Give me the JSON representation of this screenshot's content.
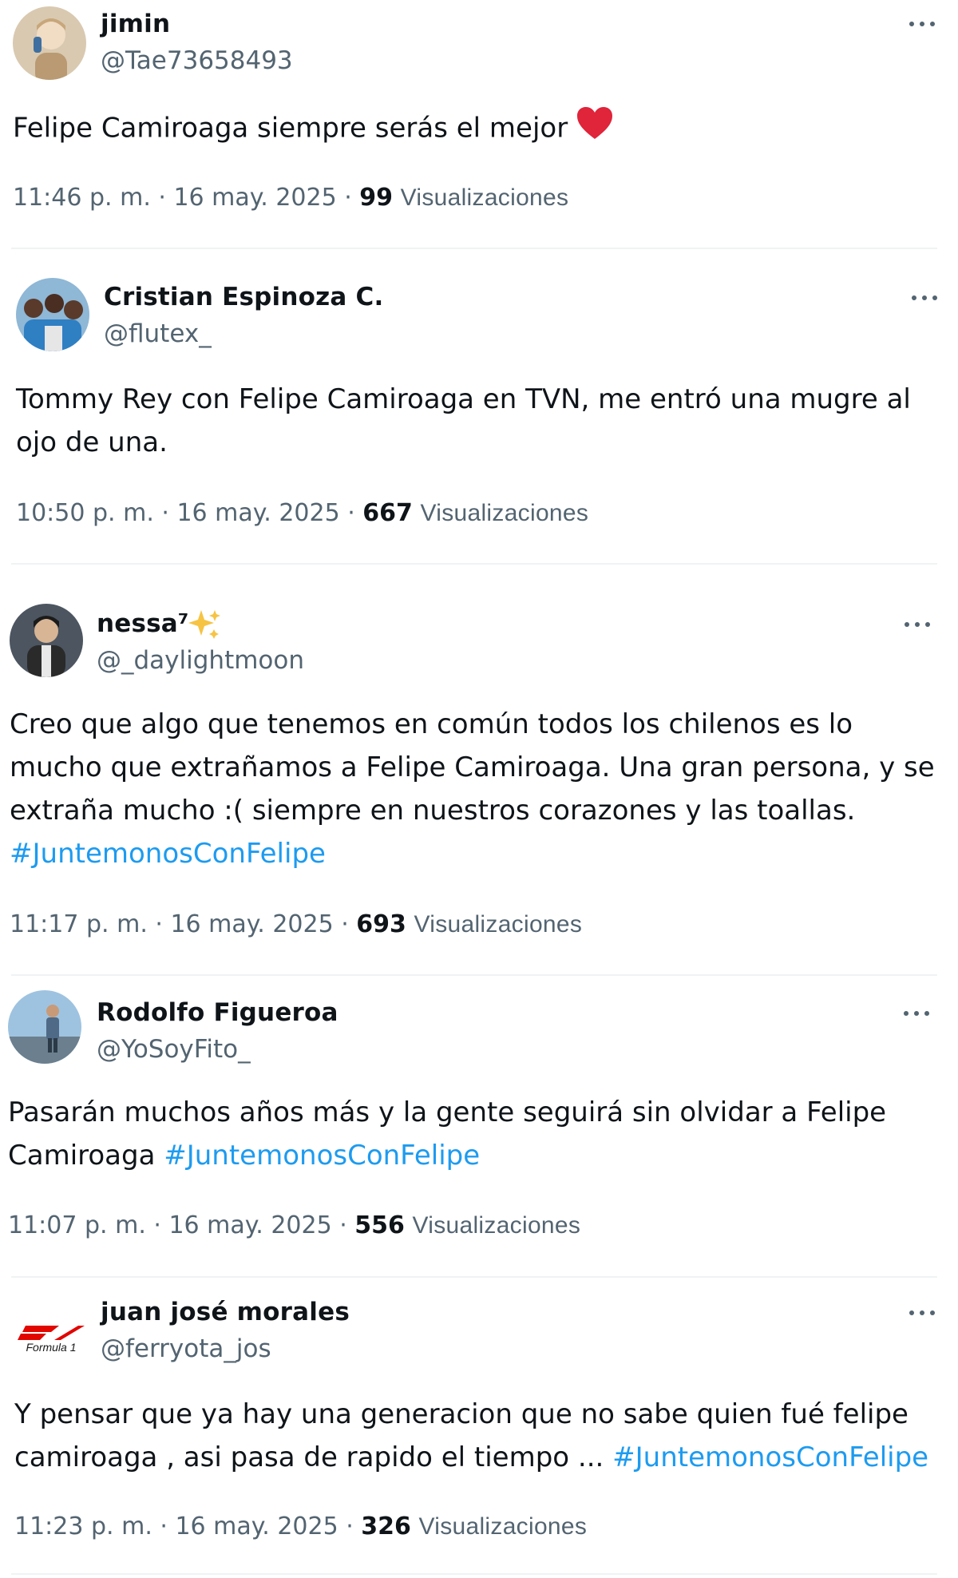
{
  "tweets": [
    {
      "name": "jimin",
      "handle": "@Tae73658493",
      "lines": [
        "Felipe Camiroaga siempre serás el mejor"
      ],
      "emoji": "red-heart",
      "time": "11:46 p. m. · 16 may. 2025 · ",
      "views": "99",
      "views_label": "Visualizaciones"
    },
    {
      "name": "Cristian Espinoza C.",
      "handle": "@flutex_",
      "lines": [
        "Tommy Rey con Felipe Camiroaga en TVN, me entró una mugre al",
        "ojo de una."
      ],
      "time": "10:50 p. m. · 16 may. 2025 · ",
      "views": "667",
      "views_label": "Visualizaciones"
    },
    {
      "name": "nessa⁷",
      "name_emoji": "sparkles",
      "handle": "@_daylightmoon",
      "lines": [
        "Creo que algo que tenemos en común todos los chilenos es lo",
        "mucho que extrañamos a Felipe Camiroaga. Una gran persona, y se",
        "extraña mucho :( siempre en nuestros corazones y las toallas."
      ],
      "hashtag": "#JuntemonosConFelipe",
      "time": "11:17 p. m. · 16 may. 2025 · ",
      "views": "693",
      "views_label": "Visualizaciones"
    },
    {
      "name": "Rodolfo Figueroa",
      "handle": "@YoSoyFito_",
      "lines": [
        "Pasarán muchos años más y la gente seguirá sin olvidar a Felipe",
        "Camiroaga "
      ],
      "hashtag": "#JuntemonosConFelipe",
      "time": "11:07 p. m. · 16 may. 2025 · ",
      "views": "556",
      "views_label": "Visualizaciones"
    },
    {
      "name": "juan josé morales",
      "handle": "@ferryota_jos",
      "lines": [
        "Y pensar que ya hay una generacion que no sabe quien fué felipe",
        "camiroaga , asi pasa de rapido el tiempo ... "
      ],
      "hashtag": "#JuntemonosConFelipe",
      "avatar_text": "Formula 1",
      "time": "11:23 p. m. · 16 may. 2025 · ",
      "views": "326",
      "views_label": "Visualizaciones"
    }
  ],
  "colors": {
    "text": "#0f1419",
    "secondary": "#536471",
    "link": "#1d9bf0",
    "divider": "#eff3f4"
  },
  "icons": {
    "more": "more-horizontal-icon",
    "heart": "red-heart-emoji",
    "sparkles": "sparkles-emoji"
  }
}
